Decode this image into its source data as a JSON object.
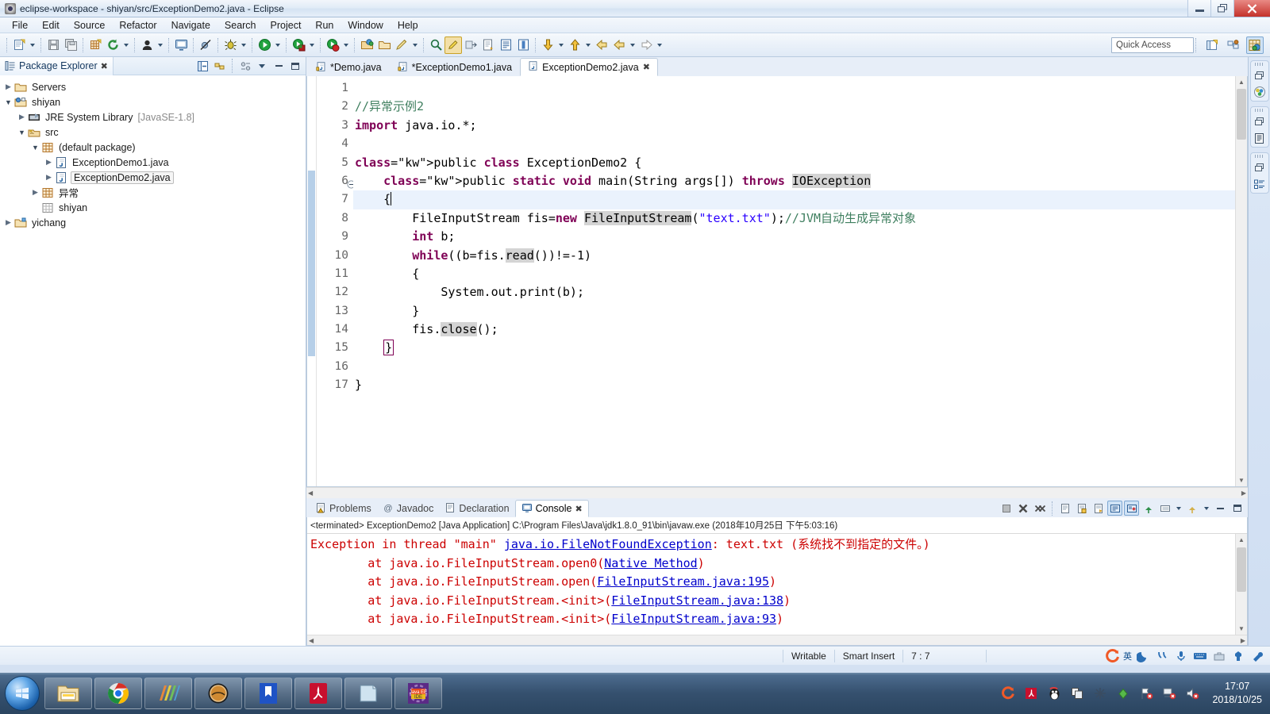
{
  "window": {
    "title": "eclipse-workspace - shiyan/src/ExceptionDemo2.java - Eclipse",
    "icon": "eclipse-icon",
    "minimize": "minimize-button",
    "maximize": "restore-button",
    "close": "close-button"
  },
  "menubar": {
    "items": [
      "File",
      "Edit",
      "Source",
      "Refactor",
      "Navigate",
      "Search",
      "Project",
      "Run",
      "Window",
      "Help"
    ]
  },
  "toolbar": {
    "quick_access_placeholder": "Quick Access",
    "quick_access_value": ""
  },
  "explorer": {
    "tab_label": "Package Explorer",
    "tree": [
      {
        "label": "Servers",
        "indent": 0,
        "arrow": "collapsed",
        "icon": "folder-icon",
        "selected": false,
        "suffix": ""
      },
      {
        "label": "shiyan",
        "indent": 0,
        "arrow": "expanded",
        "icon": "java-project-icon",
        "selected": false,
        "suffix": ""
      },
      {
        "label": "JRE System Library",
        "indent": 1,
        "arrow": "collapsed",
        "icon": "library-icon",
        "selected": false,
        "suffix": "[JavaSE-1.8]"
      },
      {
        "label": "src",
        "indent": 1,
        "arrow": "expanded",
        "icon": "source-folder-icon",
        "selected": false,
        "suffix": ""
      },
      {
        "label": "(default package)",
        "indent": 2,
        "arrow": "expanded",
        "icon": "package-icon",
        "selected": false,
        "suffix": ""
      },
      {
        "label": "ExceptionDemo1.java",
        "indent": 3,
        "arrow": "collapsed",
        "icon": "java-file-icon",
        "selected": false,
        "suffix": ""
      },
      {
        "label": "ExceptionDemo2.java",
        "indent": 3,
        "arrow": "collapsed",
        "icon": "java-file-icon",
        "selected": true,
        "suffix": ""
      },
      {
        "label": "异常",
        "indent": 2,
        "arrow": "collapsed",
        "icon": "package-icon",
        "selected": false,
        "suffix": ""
      },
      {
        "label": "shiyan",
        "indent": 2,
        "arrow": "none",
        "icon": "package-empty-icon",
        "selected": false,
        "suffix": ""
      },
      {
        "label": "yichang",
        "indent": 0,
        "arrow": "collapsed",
        "icon": "project-icon",
        "selected": false,
        "suffix": ""
      }
    ]
  },
  "editor": {
    "tabs": [
      {
        "label": "*Demo.java",
        "active": false,
        "dirty": true,
        "closable": false
      },
      {
        "label": "*ExceptionDemo1.java",
        "active": false,
        "dirty": true,
        "closable": false
      },
      {
        "label": "ExceptionDemo2.java",
        "active": true,
        "dirty": false,
        "closable": true
      }
    ],
    "line_numbers": [
      "1",
      "2",
      "3",
      "4",
      "5",
      "6",
      "7",
      "8",
      "9",
      "10",
      "11",
      "12",
      "13",
      "14",
      "15",
      "16",
      "17"
    ],
    "fold_marker_line": "6",
    "current_line": "7",
    "code_lines": [
      "",
      "//异常示例2",
      "import java.io.*;",
      "",
      "public class ExceptionDemo2 {",
      "    public static void main(String args[]) throws IOException",
      "    {",
      "        FileInputStream fis=new FileInputStream(\"text.txt\");//JVM自动生成异常对象",
      "        int b;",
      "        while((b=fis.read())!=-1)",
      "        {",
      "            System.out.print(b);",
      "        }",
      "        fis.close();",
      "    }",
      "",
      "}"
    ]
  },
  "console": {
    "tabs": [
      {
        "label": "Problems",
        "active": false,
        "icon": "problems-icon"
      },
      {
        "label": "Javadoc",
        "active": false,
        "icon": "javadoc-icon"
      },
      {
        "label": "Declaration",
        "active": false,
        "icon": "declaration-icon"
      },
      {
        "label": "Console",
        "active": true,
        "icon": "console-icon"
      }
    ],
    "launch_info": "<terminated> ExceptionDemo2 [Java Application] C:\\Program Files\\Java\\jdk1.8.0_91\\bin\\javaw.exe (2018年10月25日 下午5:03:16)",
    "output_lines": [
      "Exception in thread \"main\" java.io.FileNotFoundException: text.txt (系统找不到指定的文件。)",
      "        at java.io.FileInputStream.open0(Native Method)",
      "        at java.io.FileInputStream.open(FileInputStream.java:195)",
      "        at java.io.FileInputStream.<init>(FileInputStream.java:138)",
      "        at java.io.FileInputStream.<init>(FileInputStream.java:93)"
    ]
  },
  "statusbar": {
    "writable": "Writable",
    "insert_mode": "Smart Insert",
    "position": "7 : 7"
  },
  "taskbar": {
    "clock_time": "17:07",
    "clock_date": "2018/10/25",
    "ime_language": "英"
  },
  "colors": {
    "keyword": "#7f0055",
    "string": "#2a00ff",
    "comment": "#3f7f5f",
    "field": "#0000c0",
    "error": "#cc0000",
    "link": "#0000cc",
    "occurrence_highlight": "#d4d4d4",
    "current_line": "#eaf2fd"
  }
}
